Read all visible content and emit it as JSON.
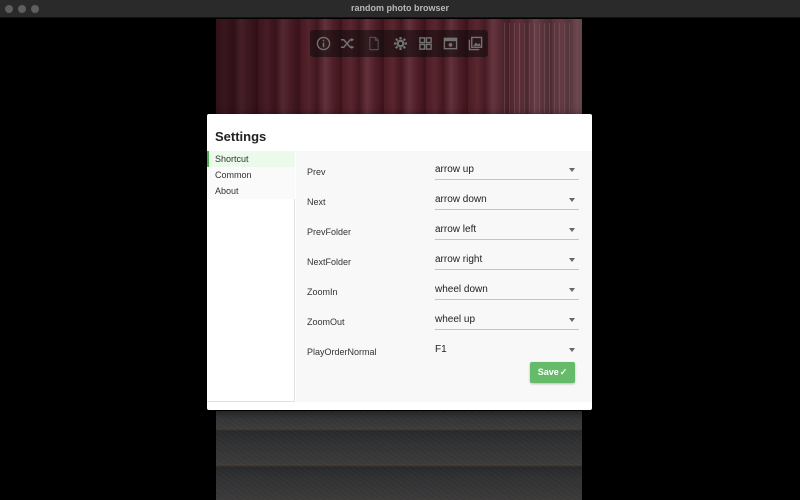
{
  "window": {
    "title": "random photo browser"
  },
  "toolbar": {
    "icons": [
      "info-icon",
      "shuffle-icon",
      "file-icon",
      "gear-icon",
      "grid-icon",
      "preview-icon",
      "gallery-icon"
    ]
  },
  "dialog": {
    "title": "Settings",
    "nav": [
      {
        "label": "Shortcut"
      },
      {
        "label": "Common"
      },
      {
        "label": "About"
      }
    ],
    "rows": [
      {
        "label": "Prev",
        "value": "arrow up"
      },
      {
        "label": "Next",
        "value": "arrow down"
      },
      {
        "label": "PrevFolder",
        "value": "arrow left"
      },
      {
        "label": "NextFolder",
        "value": "arrow right"
      },
      {
        "label": "ZoomIn",
        "value": "wheel down"
      },
      {
        "label": "ZoomOut",
        "value": "wheel up"
      },
      {
        "label": "PlayOrderNormal",
        "value": "F1"
      }
    ],
    "save_label": "Save",
    "save_check": "✓"
  },
  "colors": {
    "accent": "#66bb6a",
    "nav_active_bg": "#ecfaec",
    "nav_active_border": "#4caf50"
  }
}
